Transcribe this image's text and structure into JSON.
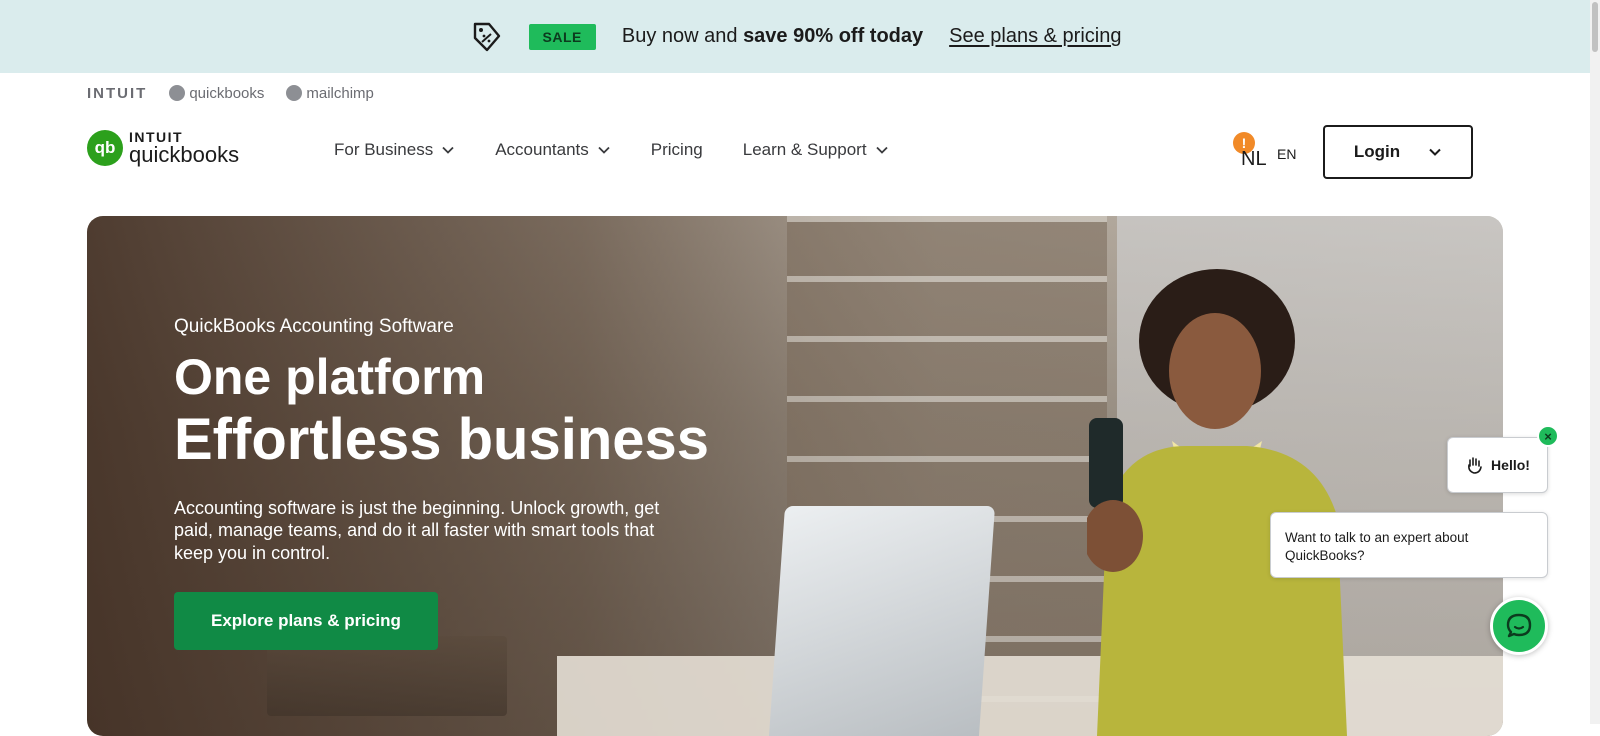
{
  "promo": {
    "tag_icon": "discount-tag-icon",
    "sale_label": "SALE",
    "message_pre": "Buy now and ",
    "message_bold": "save 90% off today",
    "link_label": "See plans & pricing",
    "bg_color": "#daeced",
    "badge_color": "#1fbb5b"
  },
  "brands": {
    "intuit": "INTUIT",
    "quickbooks": "quickbooks",
    "mailchimp": "mailchimp"
  },
  "logo": {
    "line1": "INTUIT",
    "line2": "quickbooks",
    "mark": "qb",
    "color": "#2ca01c"
  },
  "nav": {
    "items": [
      {
        "label": "For Business",
        "has_dropdown": true
      },
      {
        "label": "Accountants",
        "has_dropdown": true
      },
      {
        "label": "Pricing",
        "has_dropdown": false
      },
      {
        "label": "Learn & Support",
        "has_dropdown": true
      }
    ]
  },
  "locale": {
    "badge": "!",
    "current": "NL",
    "alternate": "EN"
  },
  "login": {
    "label": "Login"
  },
  "hero": {
    "eyebrow": "QuickBooks Accounting Software",
    "headline1": "One platform",
    "headline2": "Effortless business",
    "description": "Accounting software is just the beginning. Unlock growth, get paid, manage teams, and do it all faster with smart tools that keep you in control.",
    "cta_label": "Explore plans & pricing",
    "cta_color": "#108a45"
  },
  "chat": {
    "hello_label": "Hello!",
    "close_label": "×",
    "expert_text": "Want to talk to an expert about QuickBooks?",
    "button_color": "#1fbb5b"
  }
}
